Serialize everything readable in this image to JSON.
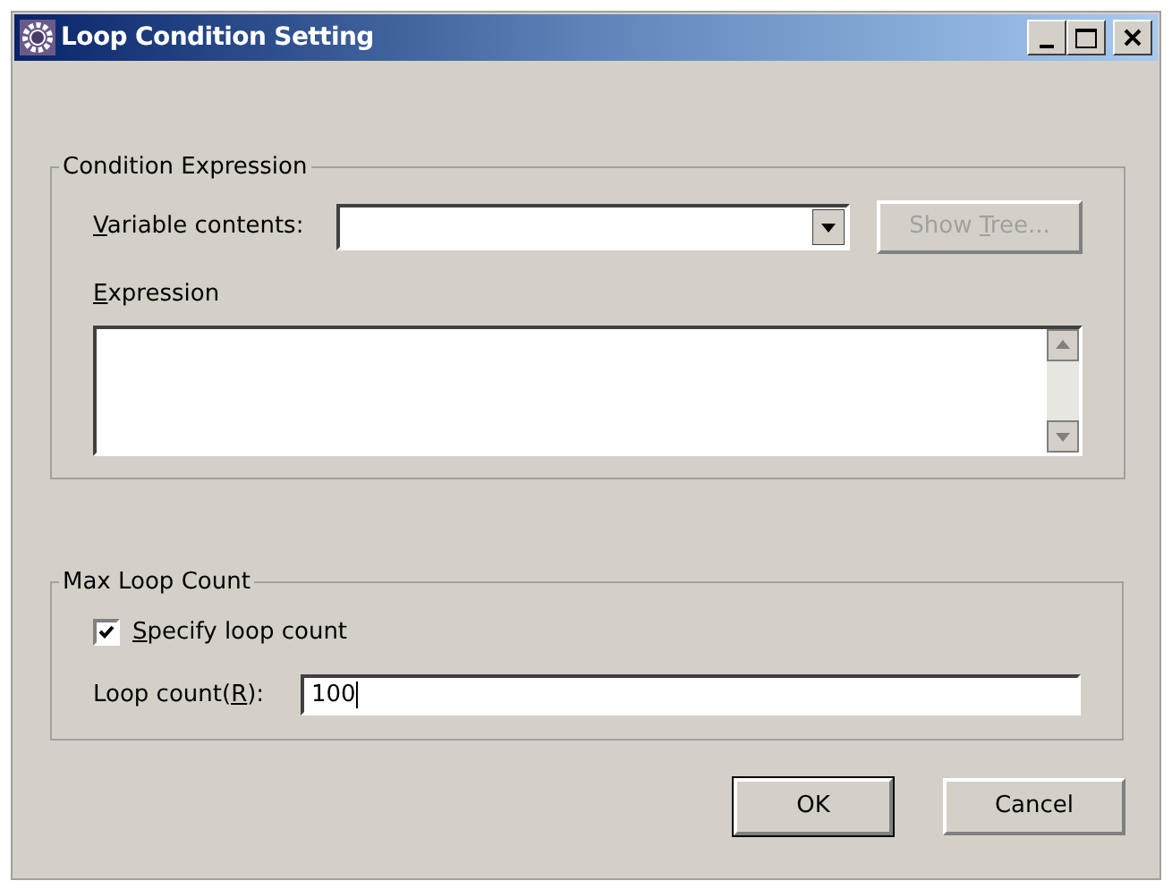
{
  "window": {
    "title": "Loop Condition Setting"
  },
  "condition_expression": {
    "title": "Condition Expression",
    "variable_contents": {
      "label": [
        {
          "text": "V",
          "underline": true
        },
        {
          "text": "ariable contents:",
          "underline": false
        }
      ]
    },
    "show_tree_button": {
      "label": [
        {
          "text": "Show ",
          "underline": false
        },
        {
          "text": "T",
          "underline": true
        },
        {
          "text": "ree...",
          "underline": false
        }
      ],
      "disabled": true
    },
    "expression": {
      "label": [
        {
          "text": "E",
          "underline": true
        },
        {
          "text": "xpression",
          "underline": false
        }
      ]
    }
  },
  "max_loop_count": {
    "title": "Max Loop Count",
    "specify_loop_count": {
      "label": [
        {
          "text": "S",
          "underline": true
        },
        {
          "text": "pecify loop count",
          "underline": false
        }
      ],
      "checked": true
    },
    "loop_count": {
      "label": [
        {
          "text": "Loop count(",
          "underline": false
        },
        {
          "text": "R",
          "underline": true
        },
        {
          "text": "):",
          "underline": false
        }
      ],
      "value": "100"
    }
  },
  "buttons": [
    {
      "label": "OK",
      "default": true
    },
    {
      "label": "Cancel",
      "default": false
    }
  ]
}
